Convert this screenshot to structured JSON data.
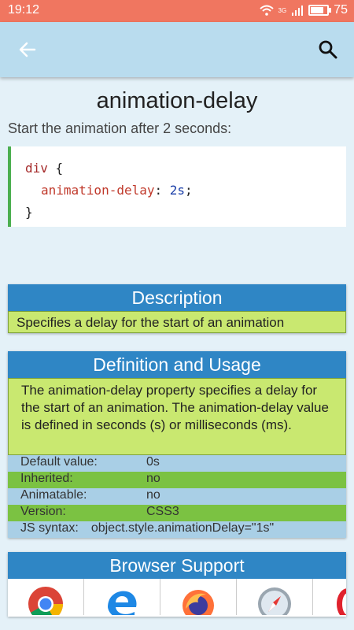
{
  "status": {
    "time": "19:12",
    "network": "3G",
    "battery": "75",
    "battery_level": 0.75
  },
  "appbar": {
    "back_icon": "arrow-left-icon",
    "search_icon": "search-icon"
  },
  "page": {
    "title": "animation-delay",
    "subtitle": "Start the animation after 2 seconds:"
  },
  "code": {
    "selector": "div",
    "open_brace": "{",
    "property": "animation-delay",
    "colon": ":",
    "value": "2s",
    "semicolon": ";",
    "close_brace": "}"
  },
  "description": {
    "heading": "Description",
    "text": "Specifies a delay for the start of an animation"
  },
  "definition": {
    "heading": "Definition and Usage",
    "text": "The animation-delay property specifies a delay for the start of an animation. The animation-delay value is defined in seconds (s) or milliseconds (ms).",
    "properties": [
      {
        "key": "Default value:",
        "value": "0s"
      },
      {
        "key": "Inherited:",
        "value": "no"
      },
      {
        "key": "Animatable:",
        "value": "no"
      },
      {
        "key": "Version:",
        "value": "CSS3"
      },
      {
        "key": "JS syntax:",
        "value": "object.style.animationDelay=\"1s\""
      }
    ]
  },
  "browser_support": {
    "heading": "Browser Support",
    "browsers": [
      "chrome-icon",
      "edge-icon",
      "firefox-icon",
      "safari-icon",
      "opera-icon"
    ]
  },
  "colors": {
    "status_bar": "#f07660",
    "app_bar": "#b9dcee",
    "panel_header": "#2f86c5",
    "panel_body": "#c9e870",
    "row_green": "#7bc242"
  }
}
